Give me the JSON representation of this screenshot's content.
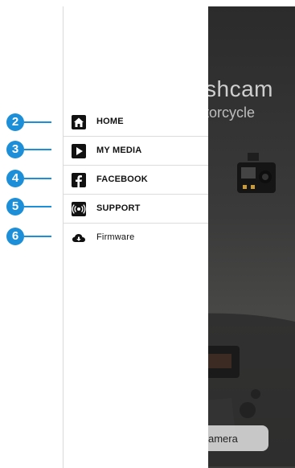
{
  "background": {
    "title_line1": "shcam",
    "title_line2": "torcycle",
    "camera_button_label": "amera"
  },
  "menu": {
    "items": [
      {
        "label": "HOME",
        "icon": "home-icon"
      },
      {
        "label": "MY MEDIA",
        "icon": "play-icon"
      },
      {
        "label": "FACEBOOK",
        "icon": "facebook-icon"
      },
      {
        "label": "SUPPORT",
        "icon": "support-icon"
      },
      {
        "label": "Firmware",
        "icon": "cloud-download-icon"
      }
    ]
  },
  "callouts": [
    "2",
    "3",
    "4",
    "5",
    "6"
  ],
  "colors": {
    "accent": "#1c8fd8"
  }
}
